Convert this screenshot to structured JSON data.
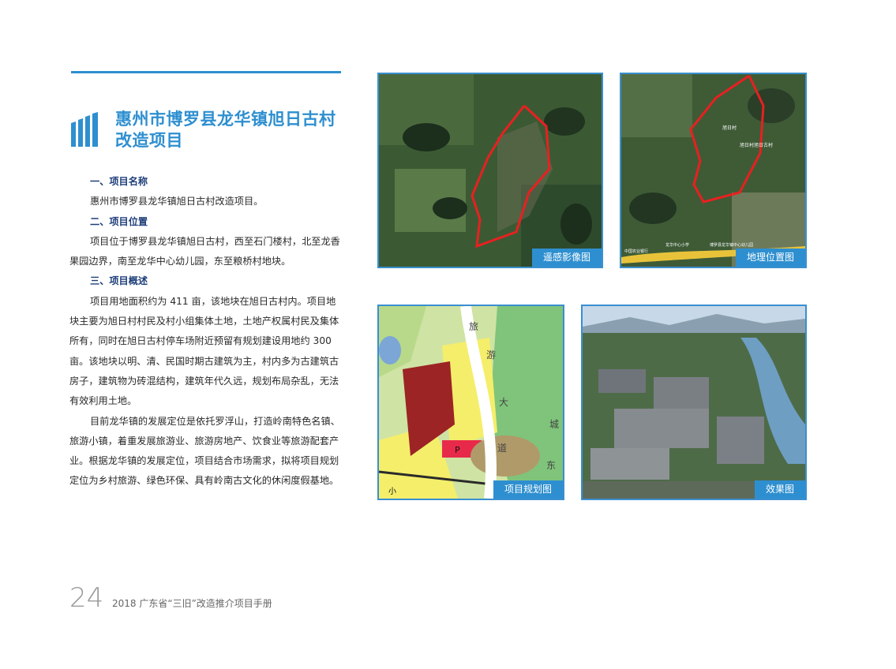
{
  "header": {
    "title_line1": "惠州市博罗县龙华镇旭日古村",
    "title_line2": "改造项目",
    "accent_color": "#2e8fd0",
    "logo_icon": "building-bars-icon"
  },
  "sections": [
    {
      "heading": "一、项目名称",
      "paragraphs": [
        "惠州市博罗县龙华镇旭日古村改造项目。"
      ]
    },
    {
      "heading": "二、项目位置",
      "paragraphs": [
        "项目位于博罗县龙华镇旭日古村，西至石门楼村，北至龙香果园边界，南至龙华中心幼儿园，东至粮桥村地块。"
      ]
    },
    {
      "heading": "三、项目概述",
      "paragraphs": [
        "项目用地面积约为 411 亩，该地块在旭日古村内。项目地块主要为旭日村村民及村小组集体土地，土地产权属村民及集体所有，同时在旭日古村停车场附近预留有规划建设用地约 300 亩。该地块以明、清、民国时期古建筑为主，村内多为古建筑古房子，建筑物为砖混结构，建筑年代久远，规划布局杂乱，无法有效利用土地。",
        "目前龙华镇的发展定位是依托罗浮山，打造岭南特色名镇、旅游小镇，着重发展旅游业、旅游房地产、饮食业等旅游配套产业。根据龙华镇的发展定位，项目结合市场需求，拟将项目规划定位为乡村旅游、绿色环保、具有岭南古文化的休闲度假基地。"
      ]
    }
  ],
  "images": {
    "remote_sensing": {
      "caption": "遥感影像图"
    },
    "location_map": {
      "caption": "地理位置图",
      "labels": [
        "旭日村",
        "旭日村旭日古村",
        "博罗县龙华镇中心幼儿园",
        "中国农业银行",
        "龙华中心小学"
      ]
    },
    "planning_map": {
      "caption": "项目规划图",
      "labels": [
        "旅",
        "游",
        "大",
        "道",
        "东",
        "城",
        "P",
        "小"
      ]
    },
    "rendering": {
      "caption": "效果图"
    }
  },
  "footer": {
    "page_number": "24",
    "publication": "2018 广东省“三旧”改造推介项目手册"
  }
}
